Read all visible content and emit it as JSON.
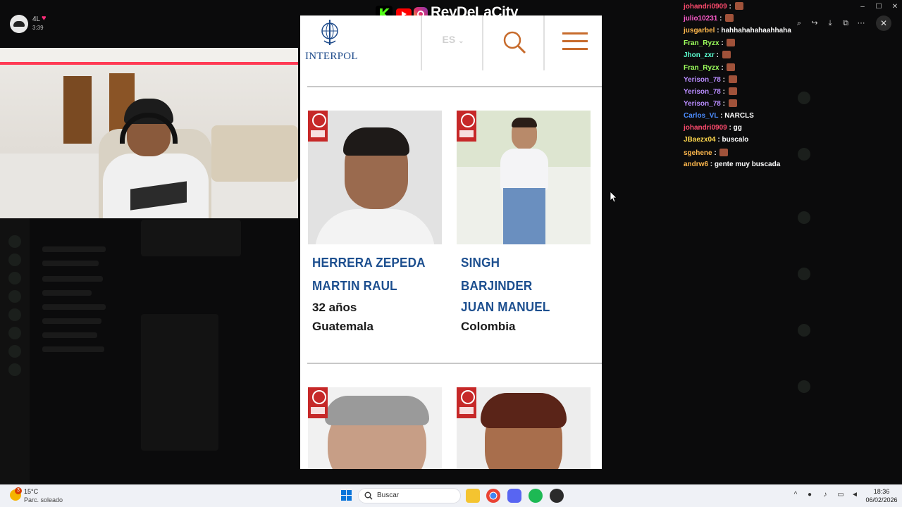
{
  "stream": {
    "streamer_name": "4L",
    "stream_time": "3:39"
  },
  "brand": {
    "name": "ReyDeLaCity",
    "icons": [
      "kick-icon",
      "youtube-icon",
      "instagram-icon"
    ]
  },
  "interpol": {
    "logo_text": "INTERPOL",
    "language": "ES",
    "cards": [
      {
        "line1": "HERRERA ZEPEDA",
        "line2": "MARTIN RAUL",
        "line3": "",
        "age": "32 años",
        "country": "Guatemala"
      },
      {
        "line1": "SINGH",
        "line2": "BARJINDER",
        "line3": "JUAN MANUEL",
        "age": "",
        "country": "Colombia"
      }
    ]
  },
  "chat": {
    "messages": [
      {
        "user": "johandri0909",
        "color": "#ff4b6e",
        "text": "",
        "emote": true
      },
      {
        "user": "julio10231",
        "color": "#ff5ccd",
        "text": "",
        "emote": true
      },
      {
        "user": "jusgarbel",
        "color": "#ffb84d",
        "text": "hahhahahahaahhaha",
        "emote": false
      },
      {
        "user": "Fran_Ryzx",
        "color": "#9cff5c",
        "text": "",
        "emote": true
      },
      {
        "user": "Jhon_zxr",
        "color": "#5cffd1",
        "text": "",
        "emote": true
      },
      {
        "user": "Fran_Ryzx",
        "color": "#9cff5c",
        "text": "",
        "emote": true
      },
      {
        "user": "Yerison_78",
        "color": "#b98cff",
        "text": "",
        "emote": true
      },
      {
        "user": "Yerison_78",
        "color": "#b98cff",
        "text": "",
        "emote": true
      },
      {
        "user": "Yerison_78",
        "color": "#b98cff",
        "text": "",
        "emote": true
      },
      {
        "user": "Carlos_VL",
        "color": "#4c8dff",
        "text": "NARCLS",
        "emote": false
      },
      {
        "user": "johandri0909",
        "color": "#ff4b6e",
        "text": "gg",
        "emote": false
      },
      {
        "user": "JBaezx04",
        "color": "#ffd84d",
        "text": "buscalo",
        "emote": false
      },
      {
        "user": "sgehene",
        "color": "#ffb84d",
        "text": "",
        "emote": true
      },
      {
        "user": "andrw6",
        "color": "#ffb84d",
        "text": "gente muy buscada",
        "emote": false
      }
    ]
  },
  "taskbar": {
    "weather_temp": "15°C",
    "weather_desc": "Parc. soleado",
    "weather_badge": "3",
    "search_placeholder": "Buscar",
    "time": "18:36",
    "date": "06/02/2026"
  },
  "colors": {
    "interpol_blue": "#1d4f8f",
    "interpol_orange": "#c76b2c",
    "red_notice": "#c62828"
  }
}
